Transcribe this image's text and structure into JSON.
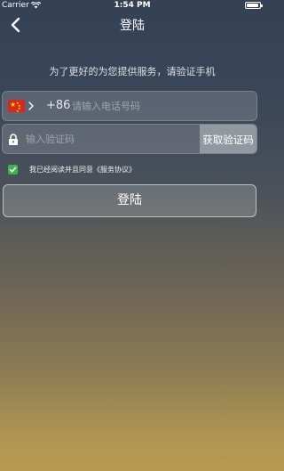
{
  "status_bar": {
    "carrier": "Carrier",
    "time": "1:54 PM",
    "battery_level": 0.95
  },
  "nav": {
    "title": "登陆",
    "back_icon": "chevron-left-icon"
  },
  "hint_text": "为了更好的为您提供服务，请验证手机",
  "phone": {
    "flag_icon": "china-flag-icon",
    "country_code": "+86",
    "placeholder": "请输入电话号码",
    "value": ""
  },
  "code": {
    "placeholder": "输入验证码",
    "value": "",
    "get_code_label": "获取验证码"
  },
  "agreement": {
    "checked": true,
    "text": "我已经阅读并且同意《服务协议》"
  },
  "login_button_label": "登陆",
  "colors": {
    "checkbox": "#3db44a",
    "flag_red": "#d7281c",
    "flag_star": "#ffde00"
  }
}
